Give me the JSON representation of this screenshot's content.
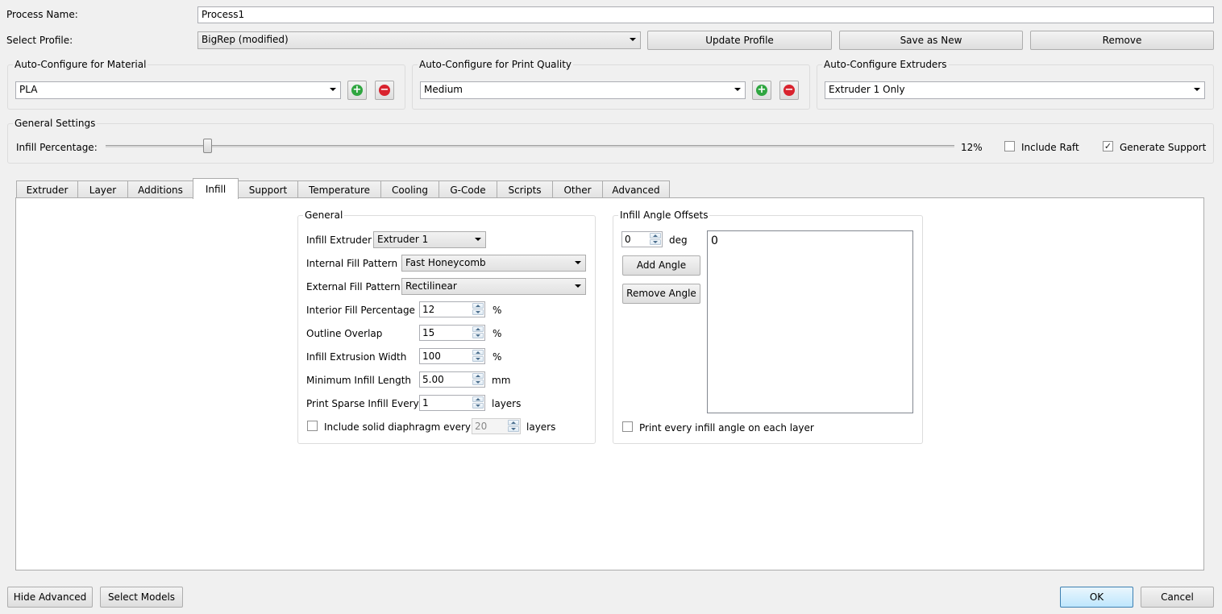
{
  "process": {
    "name_label": "Process Name:",
    "name_value": "Process1"
  },
  "profile": {
    "label": "Select Profile:",
    "selected": "BigRep (modified)",
    "update_label": "Update Profile",
    "save_new_label": "Save as New",
    "remove_label": "Remove"
  },
  "auto_material": {
    "title": "Auto-Configure for Material",
    "selected": "PLA"
  },
  "auto_quality": {
    "title": "Auto-Configure for Print Quality",
    "selected": "Medium"
  },
  "auto_extruders": {
    "title": "Auto-Configure Extruders",
    "selected": "Extruder 1 Only"
  },
  "general_settings": {
    "title": "General Settings",
    "infill_label": "Infill Percentage:",
    "infill_value": "12%",
    "infill_fraction": 0.12,
    "raft_label": "Include Raft",
    "raft_checked": false,
    "support_label": "Generate Support",
    "support_checked": true,
    "check_mark": "✓"
  },
  "tabs": [
    {
      "label": "Extruder"
    },
    {
      "label": "Layer"
    },
    {
      "label": "Additions"
    },
    {
      "label": "Infill",
      "active": true
    },
    {
      "label": "Support"
    },
    {
      "label": "Temperature"
    },
    {
      "label": "Cooling"
    },
    {
      "label": "G-Code"
    },
    {
      "label": "Scripts"
    },
    {
      "label": "Other"
    },
    {
      "label": "Advanced"
    }
  ],
  "infill_general": {
    "title": "General",
    "extruder_label": "Infill Extruder",
    "extruder_value": "Extruder 1",
    "internal_label": "Internal Fill Pattern",
    "internal_value": "Fast Honeycomb",
    "external_label": "External Fill Pattern",
    "external_value": "Rectilinear",
    "interior_pct_label": "Interior Fill Percentage",
    "interior_pct_value": "12",
    "interior_pct_unit": "%",
    "outline_label": "Outline Overlap",
    "outline_value": "15",
    "outline_unit": "%",
    "width_label": "Infill Extrusion Width",
    "width_value": "100",
    "width_unit": "%",
    "min_length_label": "Minimum Infill Length",
    "min_length_value": "5.00",
    "min_length_unit": "mm",
    "sparse_label": "Print Sparse Infill Every",
    "sparse_value": "1",
    "sparse_unit": "layers",
    "diaphragm_label": "Include solid diaphragm every",
    "diaphragm_checked": false,
    "diaphragm_value": "20",
    "diaphragm_unit": "layers"
  },
  "angle_offsets": {
    "title": "Infill Angle Offsets",
    "angle_value": "0",
    "angle_unit": "deg",
    "add_label": "Add Angle",
    "remove_label": "Remove Angle",
    "list_items": [
      "0"
    ],
    "every_layer_label": "Print every infill angle on each layer",
    "every_layer_checked": false
  },
  "footer": {
    "hide_advanced_label": "Hide Advanced",
    "select_models_label": "Select Models",
    "ok_label": "OK",
    "cancel_label": "Cancel"
  }
}
